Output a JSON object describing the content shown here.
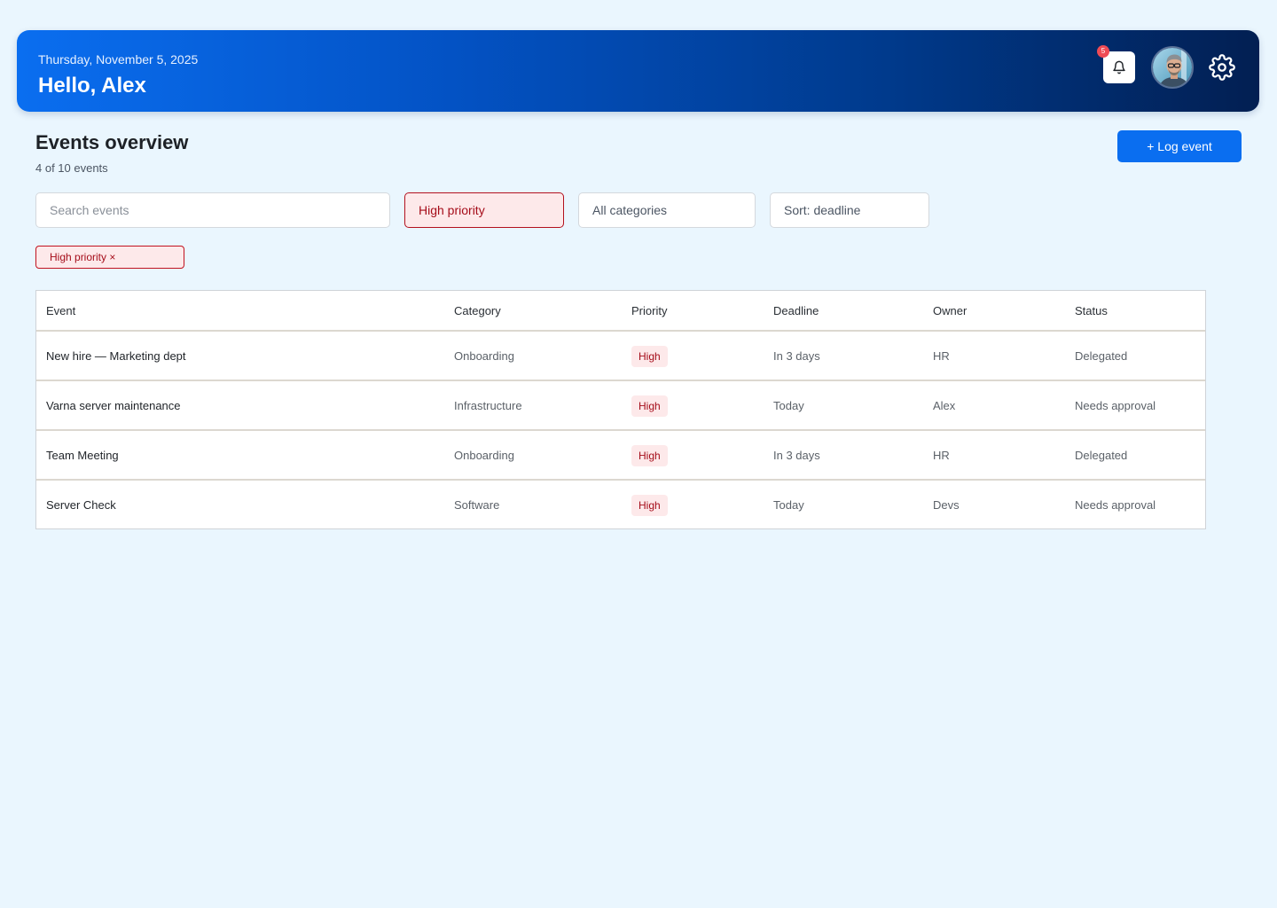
{
  "header": {
    "date": "Thursday, November 5, 2025",
    "greeting": "Hello, Alex",
    "notification_count": "5",
    "icons": {
      "notifications": "bell-icon",
      "settings": "gear-icon",
      "profile": "user-avatar"
    }
  },
  "main": {
    "title": "Events overview",
    "subtitle": "4 of 10 events",
    "log_button_label": "+ Log event"
  },
  "filters": {
    "search_placeholder": "Search events",
    "priority_value": "High priority",
    "category_value": "All categories",
    "sort_value": "Sort: deadline"
  },
  "active_filters": [
    {
      "label": "High priority ×"
    }
  ],
  "table": {
    "columns": [
      "Event",
      "Category",
      "Priority",
      "Deadline",
      "Owner",
      "Status"
    ],
    "rows": [
      {
        "event": "New hire — Marketing dept",
        "category": "Onboarding",
        "priority": "High",
        "deadline": "In 3 days",
        "owner": "HR",
        "status": "Delegated"
      },
      {
        "event": "Varna server maintenance",
        "category": "Infrastructure",
        "priority": "High",
        "deadline": "Today",
        "owner": "Alex",
        "status": "Needs approval"
      },
      {
        "event": "Team Meeting",
        "category": "Onboarding",
        "priority": "High",
        "deadline": "In 3 days",
        "owner": "HR",
        "status": "Delegated"
      },
      {
        "event": "Server Check",
        "category": "Software",
        "priority": "High",
        "deadline": "Today",
        "owner": "Devs",
        "status": "Needs approval"
      }
    ]
  },
  "colors": {
    "background": "#eaf6fe",
    "accent": "#0a6ef0",
    "priority_high_bg": "#fde9ea",
    "priority_high_text": "#a50d1a",
    "badge": "#ef4b55"
  }
}
